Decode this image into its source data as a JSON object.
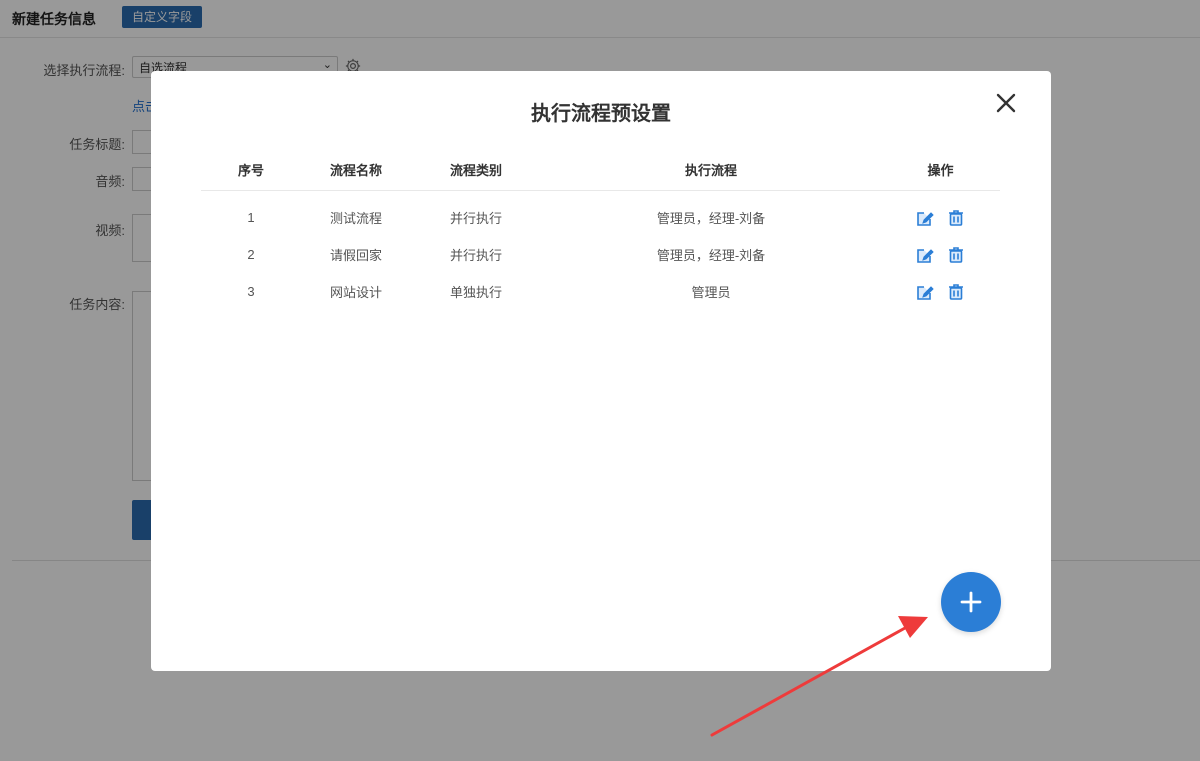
{
  "page": {
    "title": "新建任务信息",
    "custom_field_button": "自定义字段",
    "flow_label": "选择执行流程:",
    "flow_select_value": "自选流程",
    "hint_link": "点击",
    "task_title_label": "任务标题:",
    "audio_label": "音频:",
    "video_label": "视频:",
    "content_label": "任务内容:"
  },
  "modal": {
    "title": "执行流程预设置",
    "columns": [
      "序号",
      "流程名称",
      "流程类别",
      "执行流程",
      "操作"
    ],
    "rows": [
      {
        "index": "1",
        "name": "测试流程",
        "category": "并行执行",
        "flow": "管理员，经理-刘备"
      },
      {
        "index": "2",
        "name": "请假回家",
        "category": "并行执行",
        "flow": "管理员，经理-刘备"
      },
      {
        "index": "3",
        "name": "网站设计",
        "category": "单独执行",
        "flow": "管理员"
      }
    ]
  },
  "icons": {
    "close": "close-icon",
    "edit": "edit-icon",
    "delete": "trash-icon",
    "add": "plus-icon",
    "settings": "gear-icon"
  },
  "colors": {
    "primary": "#2b6cb0",
    "add_button": "#2b7ed6",
    "icon_blue": "#2b7ed6",
    "link": "#1e6fd0",
    "annotation_arrow": "#ee3b3b"
  }
}
